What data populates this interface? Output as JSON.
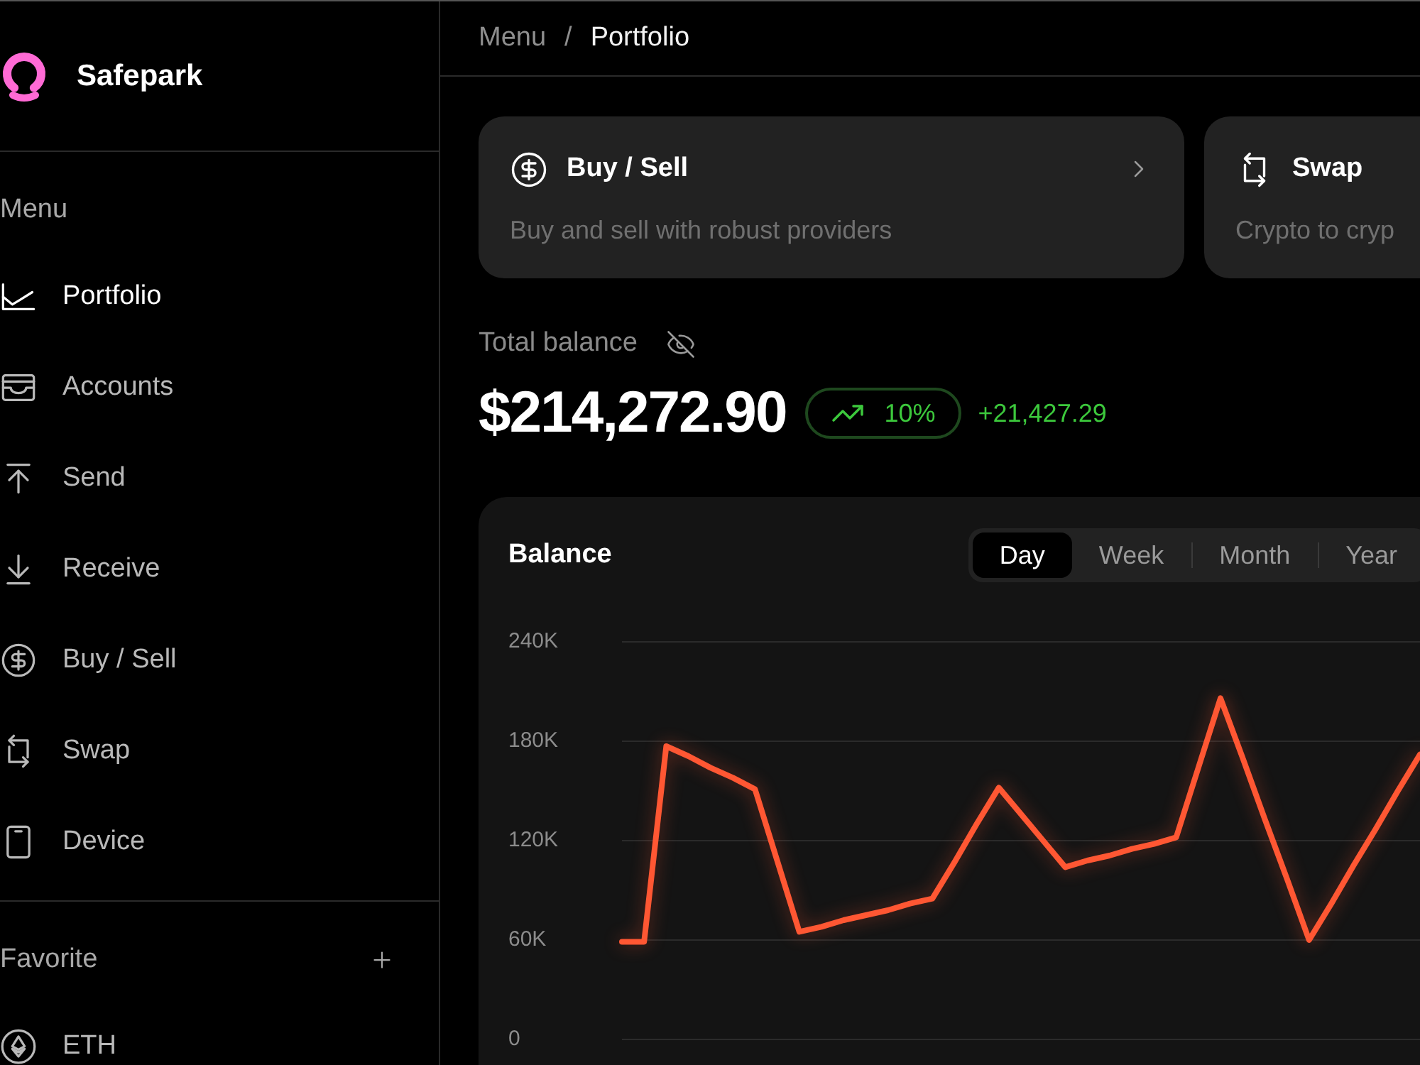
{
  "brand": {
    "name": "Safepark"
  },
  "sidebar": {
    "section_label": "Menu",
    "items": [
      {
        "kind": "portfolio",
        "label": "Portfolio",
        "selected": true
      },
      {
        "kind": "accounts",
        "label": "Accounts",
        "selected": false
      },
      {
        "kind": "send",
        "label": "Send",
        "selected": false
      },
      {
        "kind": "receive",
        "label": "Receive",
        "selected": false
      },
      {
        "kind": "buy_sell",
        "label": "Buy / Sell",
        "selected": false
      },
      {
        "kind": "swap",
        "label": "Swap",
        "selected": false
      },
      {
        "kind": "device",
        "label": "Device",
        "selected": false
      }
    ],
    "favorites": {
      "label": "Favorite",
      "items": [
        {
          "kind": "eth",
          "label": "ETH"
        }
      ]
    }
  },
  "breadcrumb": {
    "separator": "/",
    "items": [
      {
        "label": "Menu",
        "current": false
      },
      {
        "label": "Portfolio",
        "current": true
      }
    ]
  },
  "action_cards": [
    {
      "kind": "buy_sell",
      "title": "Buy / Sell",
      "description": "Buy and sell with robust providers",
      "chevron": true
    },
    {
      "kind": "swap",
      "title": "Swap",
      "description": "Crypto to cryp",
      "chevron": false
    }
  ],
  "balance": {
    "label": "Total balance",
    "amount": "$214,272.90",
    "rising": true,
    "change_percent": "10%",
    "change_amount": "+21,427.29"
  },
  "chart_panel": {
    "ranges": [
      {
        "label": "Day",
        "selected": true
      },
      {
        "label": "Week",
        "selected": false
      },
      {
        "label": "Month",
        "selected": false
      },
      {
        "label": "Year",
        "selected": false
      }
    ],
    "chart_data": {
      "type": "line",
      "title": "Balance",
      "categories": [
        null,
        null,
        null,
        null,
        null,
        null,
        null,
        null,
        null,
        null,
        null,
        null,
        null,
        null,
        null,
        null,
        null,
        null,
        null,
        null,
        null,
        null,
        null,
        null,
        null,
        null,
        null,
        null,
        null,
        null,
        null,
        null,
        null,
        null,
        null,
        null,
        null
      ],
      "series": [
        {
          "color": "#ff5733",
          "values": [
            59,
            59,
            177,
            171,
            164,
            158,
            151,
            108,
            65,
            68,
            72,
            75,
            78,
            82,
            85,
            107,
            130,
            152,
            136,
            120,
            104,
            108,
            111,
            115,
            118,
            122,
            164,
            206,
            170,
            133,
            97,
            60,
            82,
            105,
            127,
            150,
            172
          ]
        }
      ],
      "ylim": [
        0,
        240
      ],
      "yticks": [
        {
          "value": 0,
          "label": "0"
        },
        {
          "value": 60,
          "label": "60K"
        },
        {
          "value": 120,
          "label": "120K"
        },
        {
          "value": 180,
          "label": "180K"
        },
        {
          "value": 240,
          "label": "240K"
        }
      ],
      "grid": true
    }
  }
}
